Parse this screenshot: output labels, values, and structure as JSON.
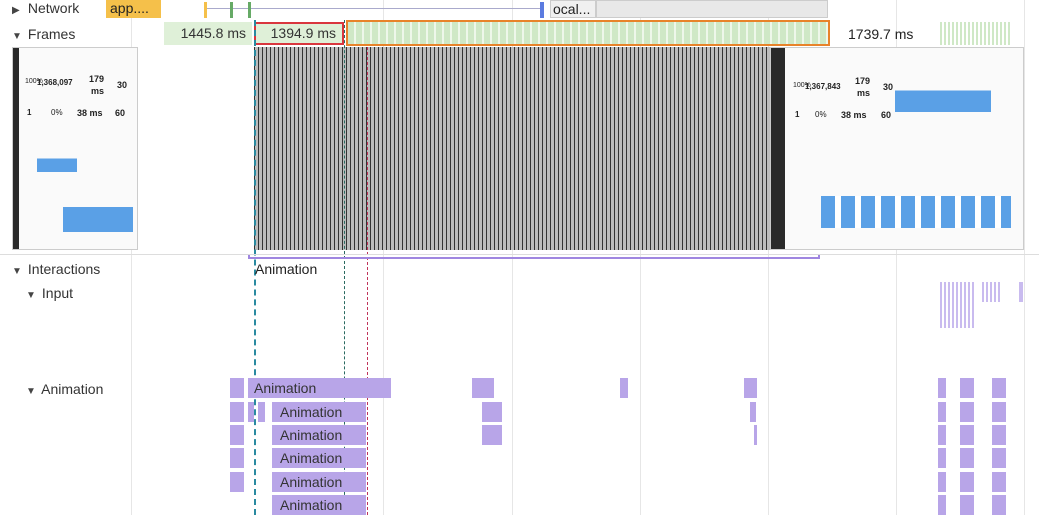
{
  "tracks": {
    "network": "Network",
    "frames": "Frames",
    "interactions": "Interactions",
    "input": "Input",
    "animation": "Animation"
  },
  "network_chips": [
    "app....",
    "ocal..."
  ],
  "frames": {
    "f1": "1445.8 ms",
    "f2": "1394.9 ms",
    "f3": "1739.7 ms"
  },
  "interaction_label": "Animation",
  "animation_labels": [
    "Animation",
    "Animation",
    "Animation",
    "Animation",
    "Animation",
    "Animation"
  ],
  "screenshot": {
    "values_left": [
      "100%",
      "1,368,097",
      "179",
      "ms",
      "30",
      "1",
      "0%",
      "38 ms",
      "60"
    ],
    "values_right": [
      "100%",
      "1,367,843",
      "179",
      "ms",
      "30",
      "1",
      "0%",
      "38 ms",
      "60"
    ]
  },
  "colors": {
    "frame_green": "#dff0d8",
    "animation_purple": "#b8a5e8",
    "selection_red": "#d9363e",
    "selection_orange": "#e8832a",
    "network_yellow": "#f5c04a"
  }
}
